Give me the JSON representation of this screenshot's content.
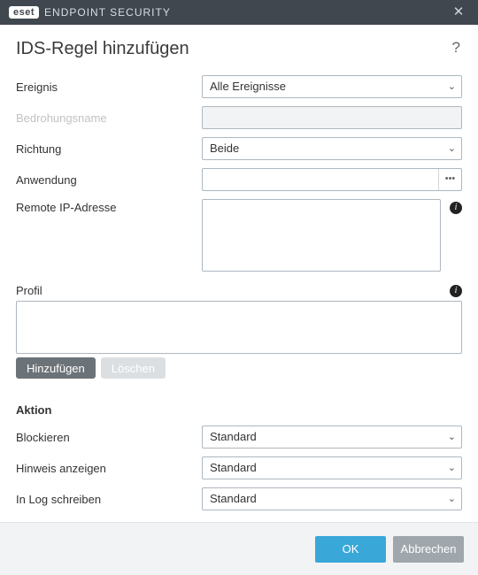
{
  "titlebar": {
    "brand_box": "eset",
    "brand_title": "ENDPOINT SECURITY",
    "close": "✕",
    "help": "?"
  },
  "heading": "IDS-Regel hinzufügen",
  "fields": {
    "event_label": "Ereignis",
    "event_value": "Alle Ereignisse",
    "threat_label": "Bedrohungsname",
    "threat_value": "",
    "direction_label": "Richtung",
    "direction_value": "Beide",
    "app_label": "Anwendung",
    "app_value": "",
    "remoteip_label": "Remote IP-Adresse",
    "remoteip_value": ""
  },
  "profil": {
    "label": "Profil",
    "add": "Hinzufügen",
    "del": "Löschen"
  },
  "action": {
    "section": "Aktion",
    "block_label": "Blockieren",
    "block_value": "Standard",
    "notify_label": "Hinweis anzeigen",
    "notify_value": "Standard",
    "log_label": "In Log schreiben",
    "log_value": "Standard"
  },
  "buttons": {
    "ok": "OK",
    "cancel": "Abbrechen"
  }
}
